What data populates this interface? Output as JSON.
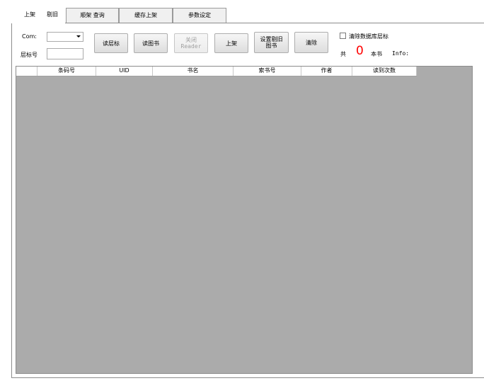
{
  "tabs": [
    {
      "label": "上架"
    },
    {
      "label": "剔旧"
    },
    {
      "label": "顺架 查询"
    },
    {
      "label": "缓存上架"
    },
    {
      "label": "参数设定"
    }
  ],
  "form": {
    "com_label": "Com:",
    "com_value": "",
    "shelf_label": "层标号",
    "shelf_value": ""
  },
  "buttons": {
    "read_shelf": "读层标",
    "read_book": "读图书",
    "close_reader": "关闭\nReader",
    "shelve": "上架",
    "set_weed": "设置剔旧\n图书",
    "clear": "清除"
  },
  "options": {
    "clear_db_shelf": "清除数据库层标"
  },
  "summary": {
    "prefix": "共",
    "count": "0",
    "suffix": "本书",
    "info_label": "Info:"
  },
  "table": {
    "columns": [
      "条码号",
      "UID",
      "书名",
      "索书号",
      "作者",
      "读到次数"
    ]
  }
}
